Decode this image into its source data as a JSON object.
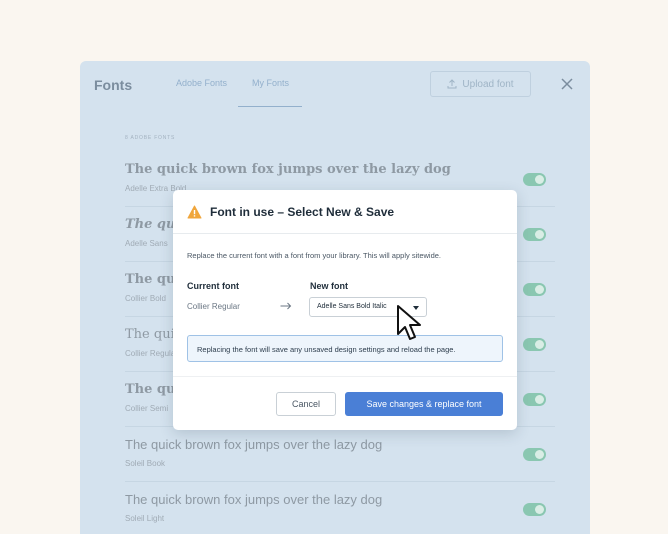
{
  "panel": {
    "title": "Fonts",
    "tabs": [
      {
        "label": "Adobe Fonts"
      },
      {
        "label": "My Fonts"
      }
    ],
    "upload_label": "Upload font",
    "section_label": "8 ADOBE FONTS",
    "sample_text": "The quick brown fox jumps over the lazy dog",
    "rows": [
      {
        "sample": "The quick brown fox jumps over the lazy dog",
        "name": "Adelle Extra Bold"
      },
      {
        "sample": "The quic",
        "name": "Adelle Sans"
      },
      {
        "sample": "The quic",
        "name": "Collier Bold"
      },
      {
        "sample": "The quic",
        "name": "Collier Regular"
      },
      {
        "sample": "The quic",
        "name": "Collier Semi"
      },
      {
        "sample": "The quick brown fox jumps over the lazy dog",
        "name": "Soleil Book"
      },
      {
        "sample": "The quick brown fox jumps over the lazy dog",
        "name": "Soleil Light"
      }
    ]
  },
  "modal": {
    "title": "Font in use – Select New & Save",
    "description": "Replace the current font with a font from your library. This will apply sitewide.",
    "current_label": "Current font",
    "current_value": "Collier Regular",
    "new_label": "New font",
    "new_value": "Adelle Sans Bold Italic",
    "info": "Replacing the font will save any unsaved design settings and reload the page.",
    "cancel_label": "Cancel",
    "save_label": "Save changes & replace font"
  },
  "colors": {
    "accent": "#4a7fd6",
    "warning": "#f0a63c",
    "toggle_on": "#8ac7b1",
    "panel_bg": "#d4e2ee"
  }
}
